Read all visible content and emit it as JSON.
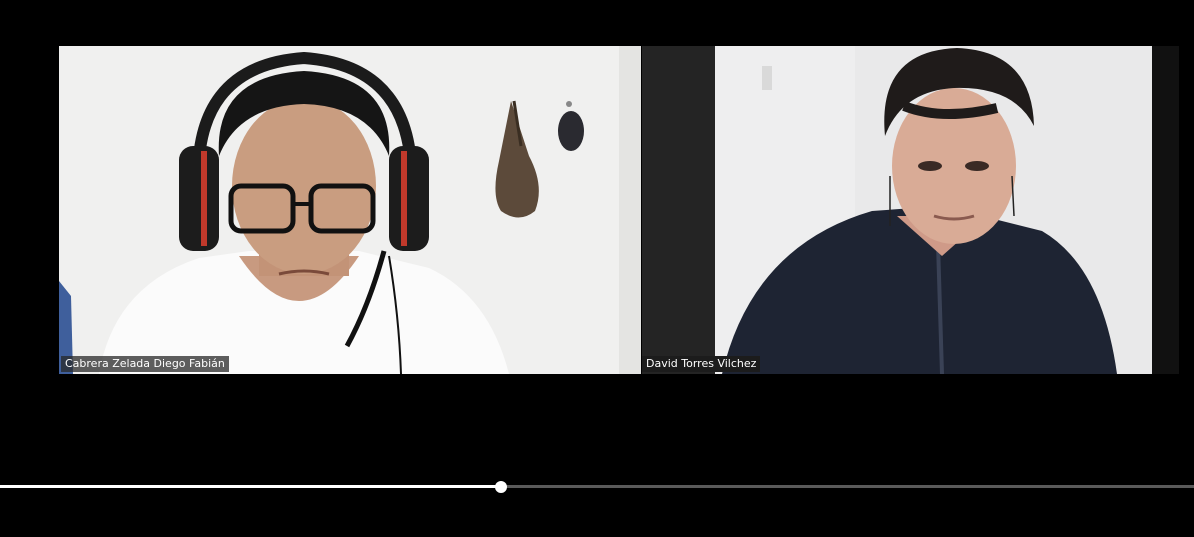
{
  "participants": [
    {
      "name": "Cabrera Zelada Diego Fabián"
    },
    {
      "name": "David Torres Vilchez"
    }
  ],
  "playback": {
    "progress": 0.42
  },
  "colors": {
    "background": "#000000",
    "progress_fill": "#ffffff",
    "progress_track": "#5a5a5a"
  }
}
